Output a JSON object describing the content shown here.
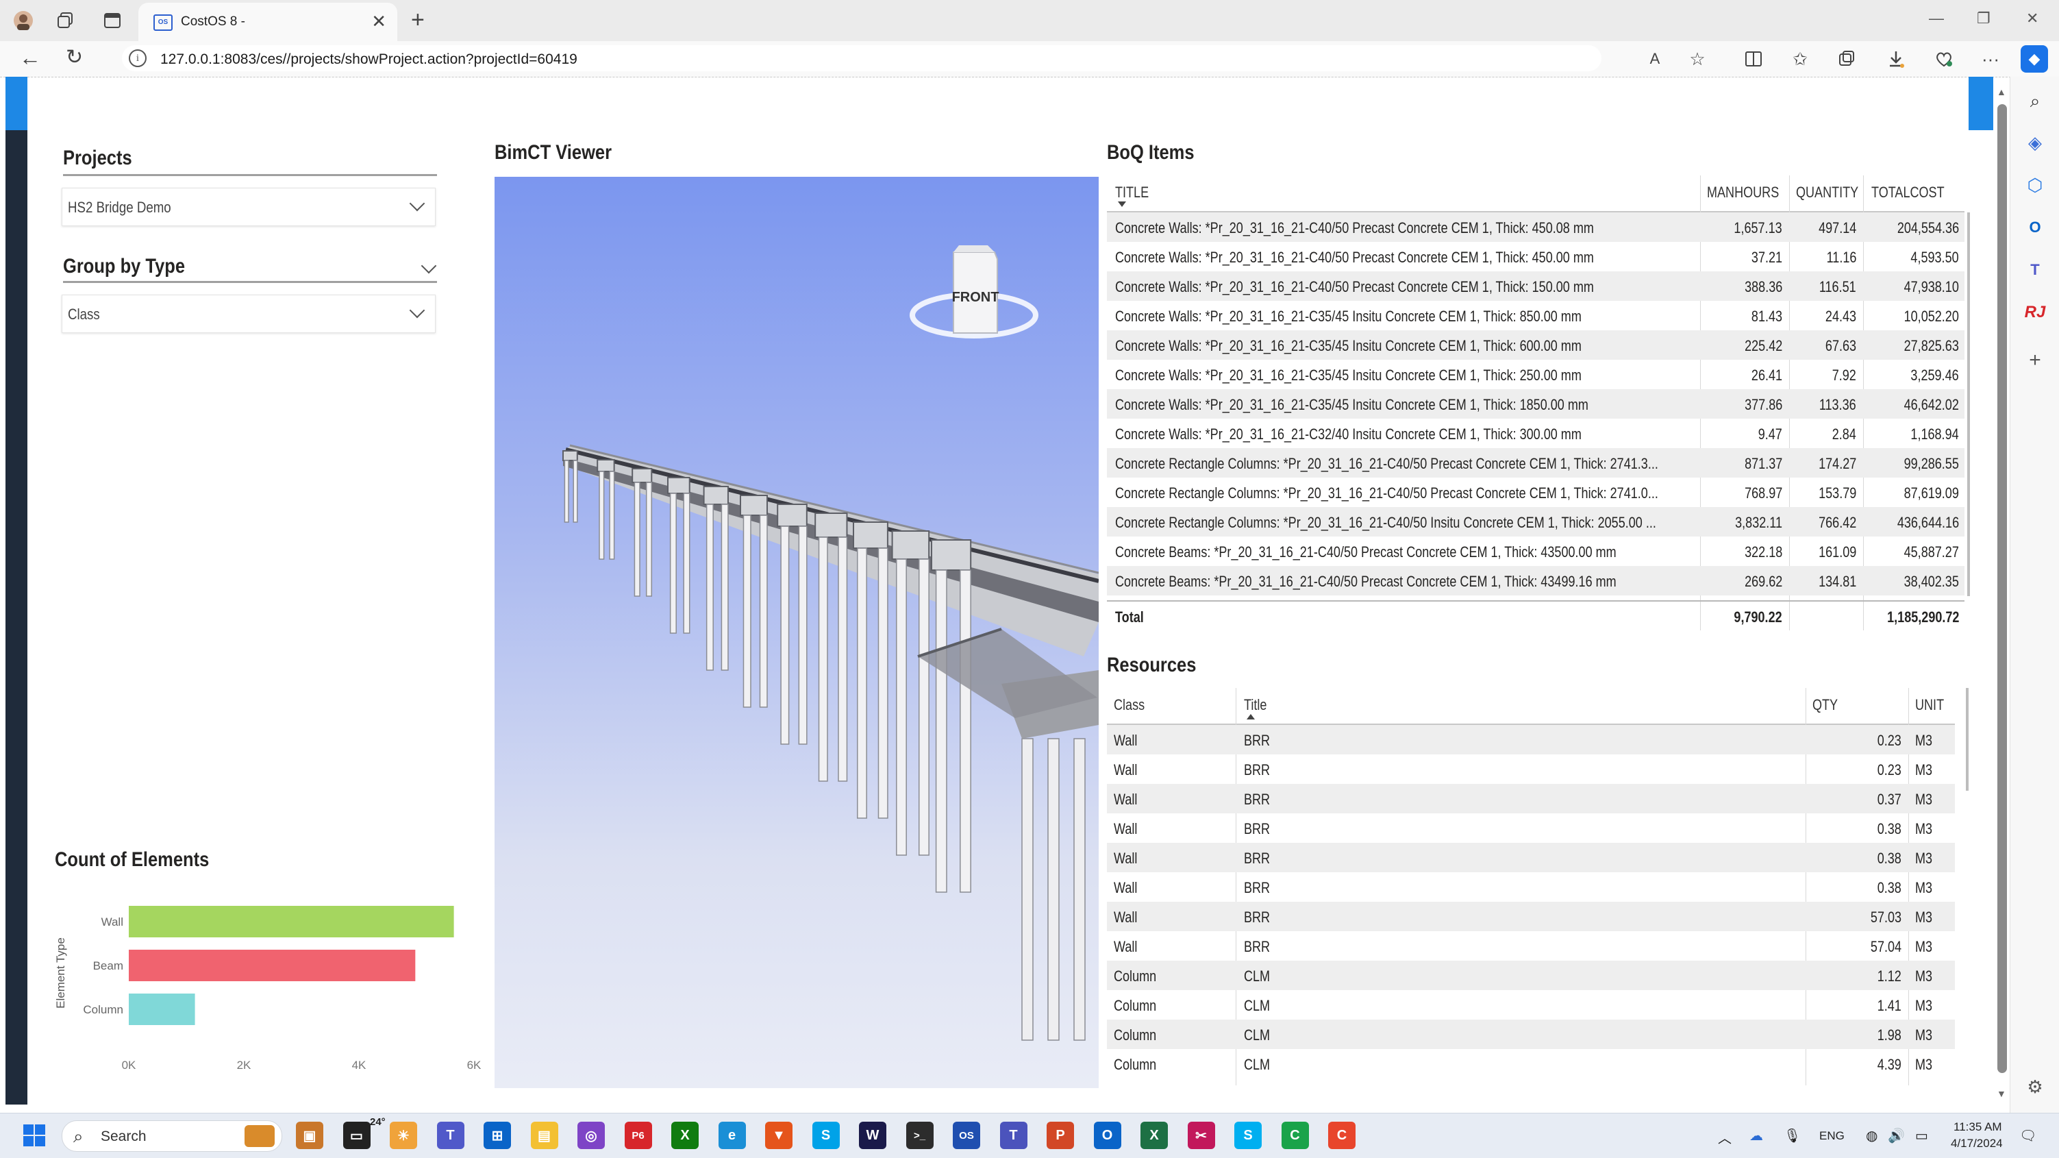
{
  "browser": {
    "tab_title": "CostOS 8 -",
    "tab_favicon_text": "OS",
    "url": "127.0.0.1:8083/ces//projects/showProject.action?projectId=60419",
    "read_aloud_label": "A"
  },
  "slicers": {
    "projects_title": "Projects",
    "projects_value": "HS2 Bridge Demo",
    "group_title": "Group by Type",
    "group_value": "Class"
  },
  "viewer": {
    "title": "BimCT Viewer",
    "cube_face": "FRONT"
  },
  "chart": {
    "title": "Count of Elements",
    "ylabel": "Element Type"
  },
  "chart_data": {
    "type": "bar",
    "orientation": "horizontal",
    "title": "Count of Elements",
    "xlabel": "",
    "ylabel": "Element Type",
    "categories": [
      "Wall",
      "Beam",
      "Column"
    ],
    "values": [
      5650,
      4980,
      1150
    ],
    "colors": [
      "#a5d65f",
      "#f0636f",
      "#80d8d8"
    ],
    "x_ticks": [
      "0K",
      "2K",
      "4K",
      "6K"
    ],
    "xlim": [
      0,
      6000
    ],
    "grid": false
  },
  "boq": {
    "title": "BoQ Items",
    "columns": [
      "TITLE",
      "MANHOURS",
      "QUANTITY",
      "TOTALCOST"
    ],
    "rows": [
      {
        "title": "Concrete Walls: *Pr_20_31_16_21-C40/50 Precast Concrete CEM 1, Thick: 450.08 mm",
        "manhours": "1,657.13",
        "quantity": "497.14",
        "totalcost": "204,554.36"
      },
      {
        "title": "Concrete Walls: *Pr_20_31_16_21-C40/50 Precast Concrete CEM 1, Thick: 450.00 mm",
        "manhours": "37.21",
        "quantity": "11.16",
        "totalcost": "4,593.50"
      },
      {
        "title": "Concrete Walls: *Pr_20_31_16_21-C40/50 Precast Concrete CEM 1, Thick: 150.00 mm",
        "manhours": "388.36",
        "quantity": "116.51",
        "totalcost": "47,938.10"
      },
      {
        "title": "Concrete Walls: *Pr_20_31_16_21-C35/45 Insitu Concrete CEM 1, Thick: 850.00 mm",
        "manhours": "81.43",
        "quantity": "24.43",
        "totalcost": "10,052.20"
      },
      {
        "title": "Concrete Walls: *Pr_20_31_16_21-C35/45 Insitu Concrete CEM 1, Thick: 600.00 mm",
        "manhours": "225.42",
        "quantity": "67.63",
        "totalcost": "27,825.63"
      },
      {
        "title": "Concrete Walls: *Pr_20_31_16_21-C35/45 Insitu Concrete CEM 1, Thick: 250.00 mm",
        "manhours": "26.41",
        "quantity": "7.92",
        "totalcost": "3,259.46"
      },
      {
        "title": "Concrete Walls: *Pr_20_31_16_21-C35/45 Insitu Concrete CEM 1, Thick: 1850.00 mm",
        "manhours": "377.86",
        "quantity": "113.36",
        "totalcost": "46,642.02"
      },
      {
        "title": "Concrete Walls: *Pr_20_31_16_21-C32/40 Insitu Concrete CEM 1, Thick: 300.00 mm",
        "manhours": "9.47",
        "quantity": "2.84",
        "totalcost": "1,168.94"
      },
      {
        "title": "Concrete Rectangle Columns: *Pr_20_31_16_21-C40/50 Precast Concrete CEM 1, Thick: 2741.3...",
        "manhours": "871.37",
        "quantity": "174.27",
        "totalcost": "99,286.55"
      },
      {
        "title": "Concrete Rectangle Columns: *Pr_20_31_16_21-C40/50 Precast Concrete CEM 1, Thick: 2741.0...",
        "manhours": "768.97",
        "quantity": "153.79",
        "totalcost": "87,619.09"
      },
      {
        "title": "Concrete Rectangle Columns: *Pr_20_31_16_21-C40/50 Insitu Concrete CEM 1, Thick: 2055.00 ...",
        "manhours": "3,832.11",
        "quantity": "766.42",
        "totalcost": "436,644.16"
      },
      {
        "title": "Concrete Beams: *Pr_20_31_16_21-C40/50 Precast Concrete CEM 1, Thick: 43500.00 mm",
        "manhours": "322.18",
        "quantity": "161.09",
        "totalcost": "45,887.27"
      },
      {
        "title": "Concrete Beams: *Pr_20_31_16_21-C40/50 Precast Concrete CEM 1, Thick: 43499.16 mm",
        "manhours": "269.62",
        "quantity": "134.81",
        "totalcost": "38,402.35"
      }
    ],
    "total": {
      "label": "Total",
      "manhours": "9,790.22",
      "quantity": "",
      "totalcost": "1,185,290.72"
    }
  },
  "resources": {
    "title": "Resources",
    "columns": [
      "Class",
      "Title",
      "QTY",
      "UNIT"
    ],
    "rows": [
      {
        "class": "Wall",
        "title": "BRR",
        "qty": "0.23",
        "unit": "M3"
      },
      {
        "class": "Wall",
        "title": "BRR",
        "qty": "0.23",
        "unit": "M3"
      },
      {
        "class": "Wall",
        "title": "BRR",
        "qty": "0.37",
        "unit": "M3"
      },
      {
        "class": "Wall",
        "title": "BRR",
        "qty": "0.38",
        "unit": "M3"
      },
      {
        "class": "Wall",
        "title": "BRR",
        "qty": "0.38",
        "unit": "M3"
      },
      {
        "class": "Wall",
        "title": "BRR",
        "qty": "0.38",
        "unit": "M3"
      },
      {
        "class": "Wall",
        "title": "BRR",
        "qty": "57.03",
        "unit": "M3"
      },
      {
        "class": "Wall",
        "title": "BRR",
        "qty": "57.04",
        "unit": "M3"
      },
      {
        "class": "Column",
        "title": "CLM",
        "qty": "1.12",
        "unit": "M3"
      },
      {
        "class": "Column",
        "title": "CLM",
        "qty": "1.41",
        "unit": "M3"
      },
      {
        "class": "Column",
        "title": "CLM",
        "qty": "1.98",
        "unit": "M3"
      },
      {
        "class": "Column",
        "title": "CLM",
        "qty": "4.39",
        "unit": "M3"
      }
    ]
  },
  "taskbar": {
    "search_label": "Search",
    "weather": "24°",
    "lang": "ENG",
    "time": "11:35 AM",
    "date": "4/17/2024",
    "icons": [
      "widgets-icon",
      "task-view-icon",
      "weather-icon",
      "teams-icon",
      "store-icon",
      "file-explorer-icon",
      "instagram-icon",
      "p6-icon",
      "xbox-icon",
      "edge-icon",
      "brave-icon",
      "skype-icon",
      "wacom-icon",
      "terminal-icon",
      "costos-icon",
      "teams-work-icon",
      "powerpoint-icon",
      "outlook-icon",
      "excel-icon",
      "snipping-icon",
      "skype-blue-icon",
      "camtasia-green-icon",
      "camtasia-icon"
    ]
  }
}
